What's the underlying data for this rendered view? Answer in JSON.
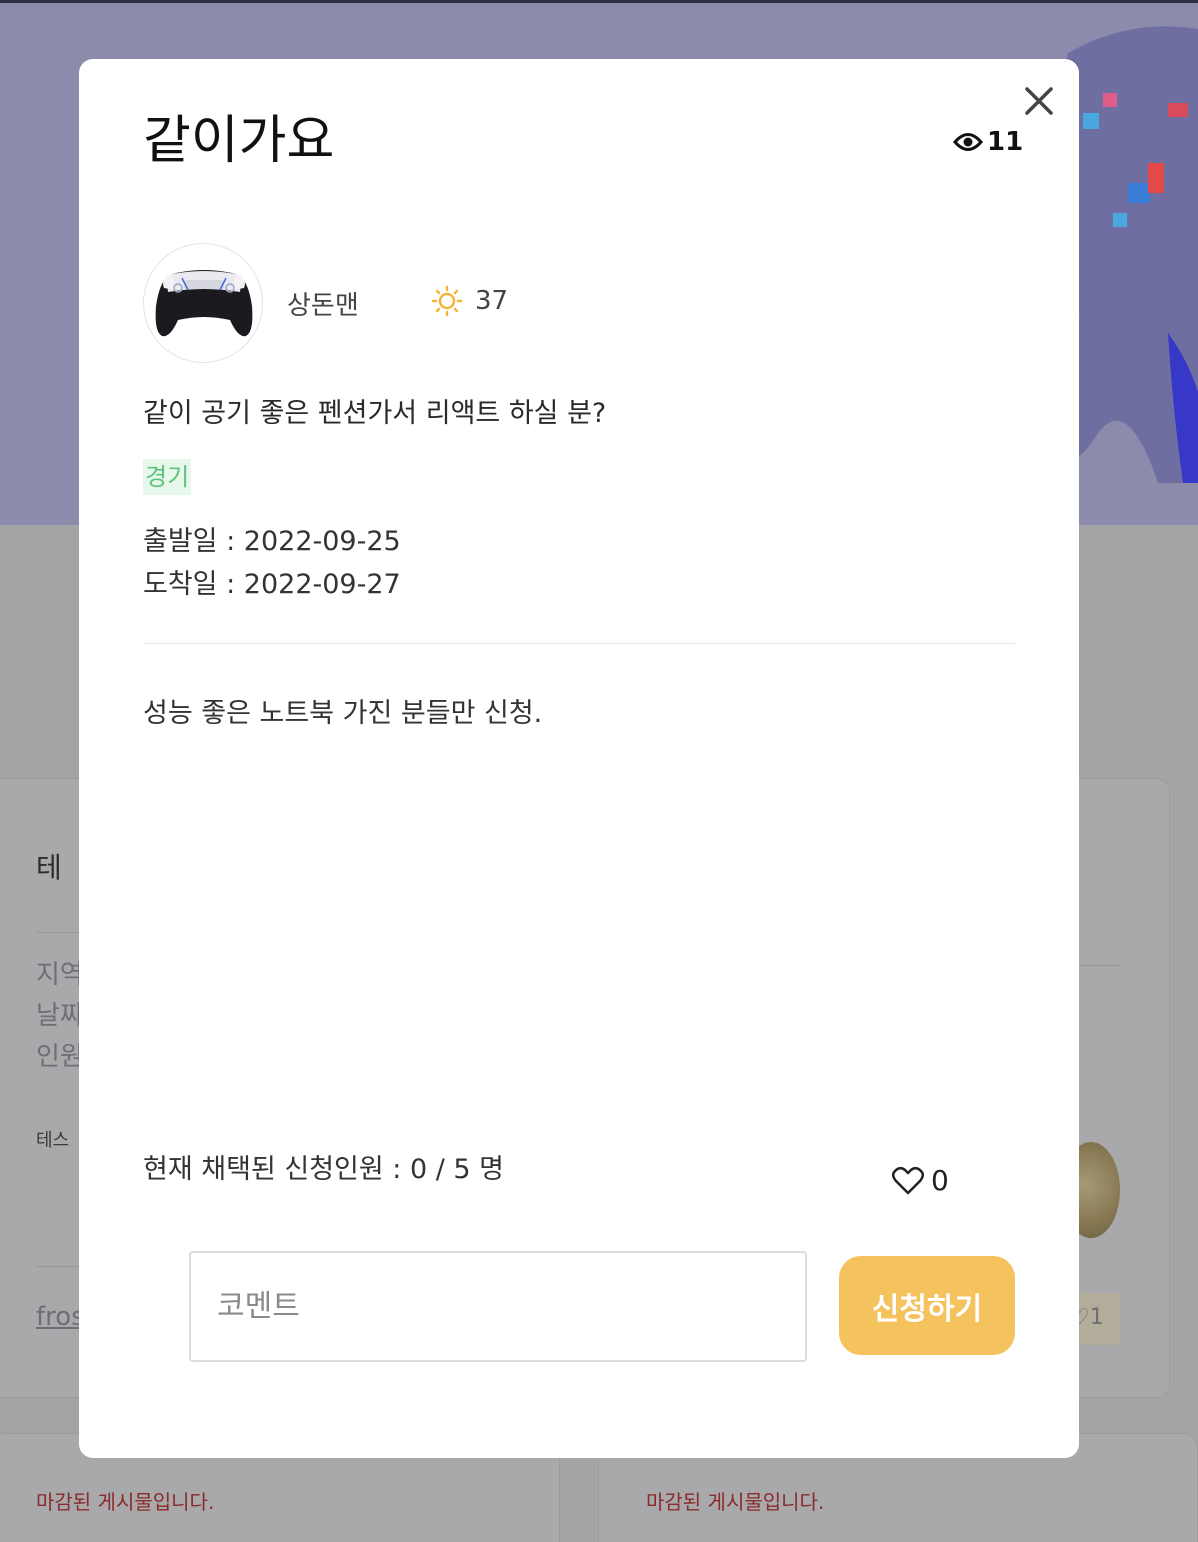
{
  "modal": {
    "title": "같이가요",
    "views": "11",
    "author": {
      "name": "상돈맨",
      "temperature": "37"
    },
    "subject": "같이 공기 좋은 펜션가서 리액트 하실 분?",
    "region": "경기",
    "depart_date": "출발일 : 2022-09-25",
    "arrive_date": "도착일 : 2022-09-27",
    "body": "성능 좋은 노트북 가진 분들만 신청.",
    "applicants": "현재 채택된 신청인원 : 0 / 5 명",
    "likes": "0",
    "comment_placeholder": "코멘트",
    "apply_label": "신청하기"
  },
  "background": {
    "card_title": "테",
    "card_lines": [
      "지역",
      "날짜",
      "인원"
    ],
    "card_small": "테스",
    "card_link": "fros",
    "closed_notice": "마감된 게시물입니다.",
    "right_likes": "1"
  },
  "colors": {
    "apply_button": "#f5c35d",
    "region_tag_text": "#5cc27d",
    "region_tag_bg": "#e8f7ec",
    "temperature_icon": "#f5b335"
  }
}
